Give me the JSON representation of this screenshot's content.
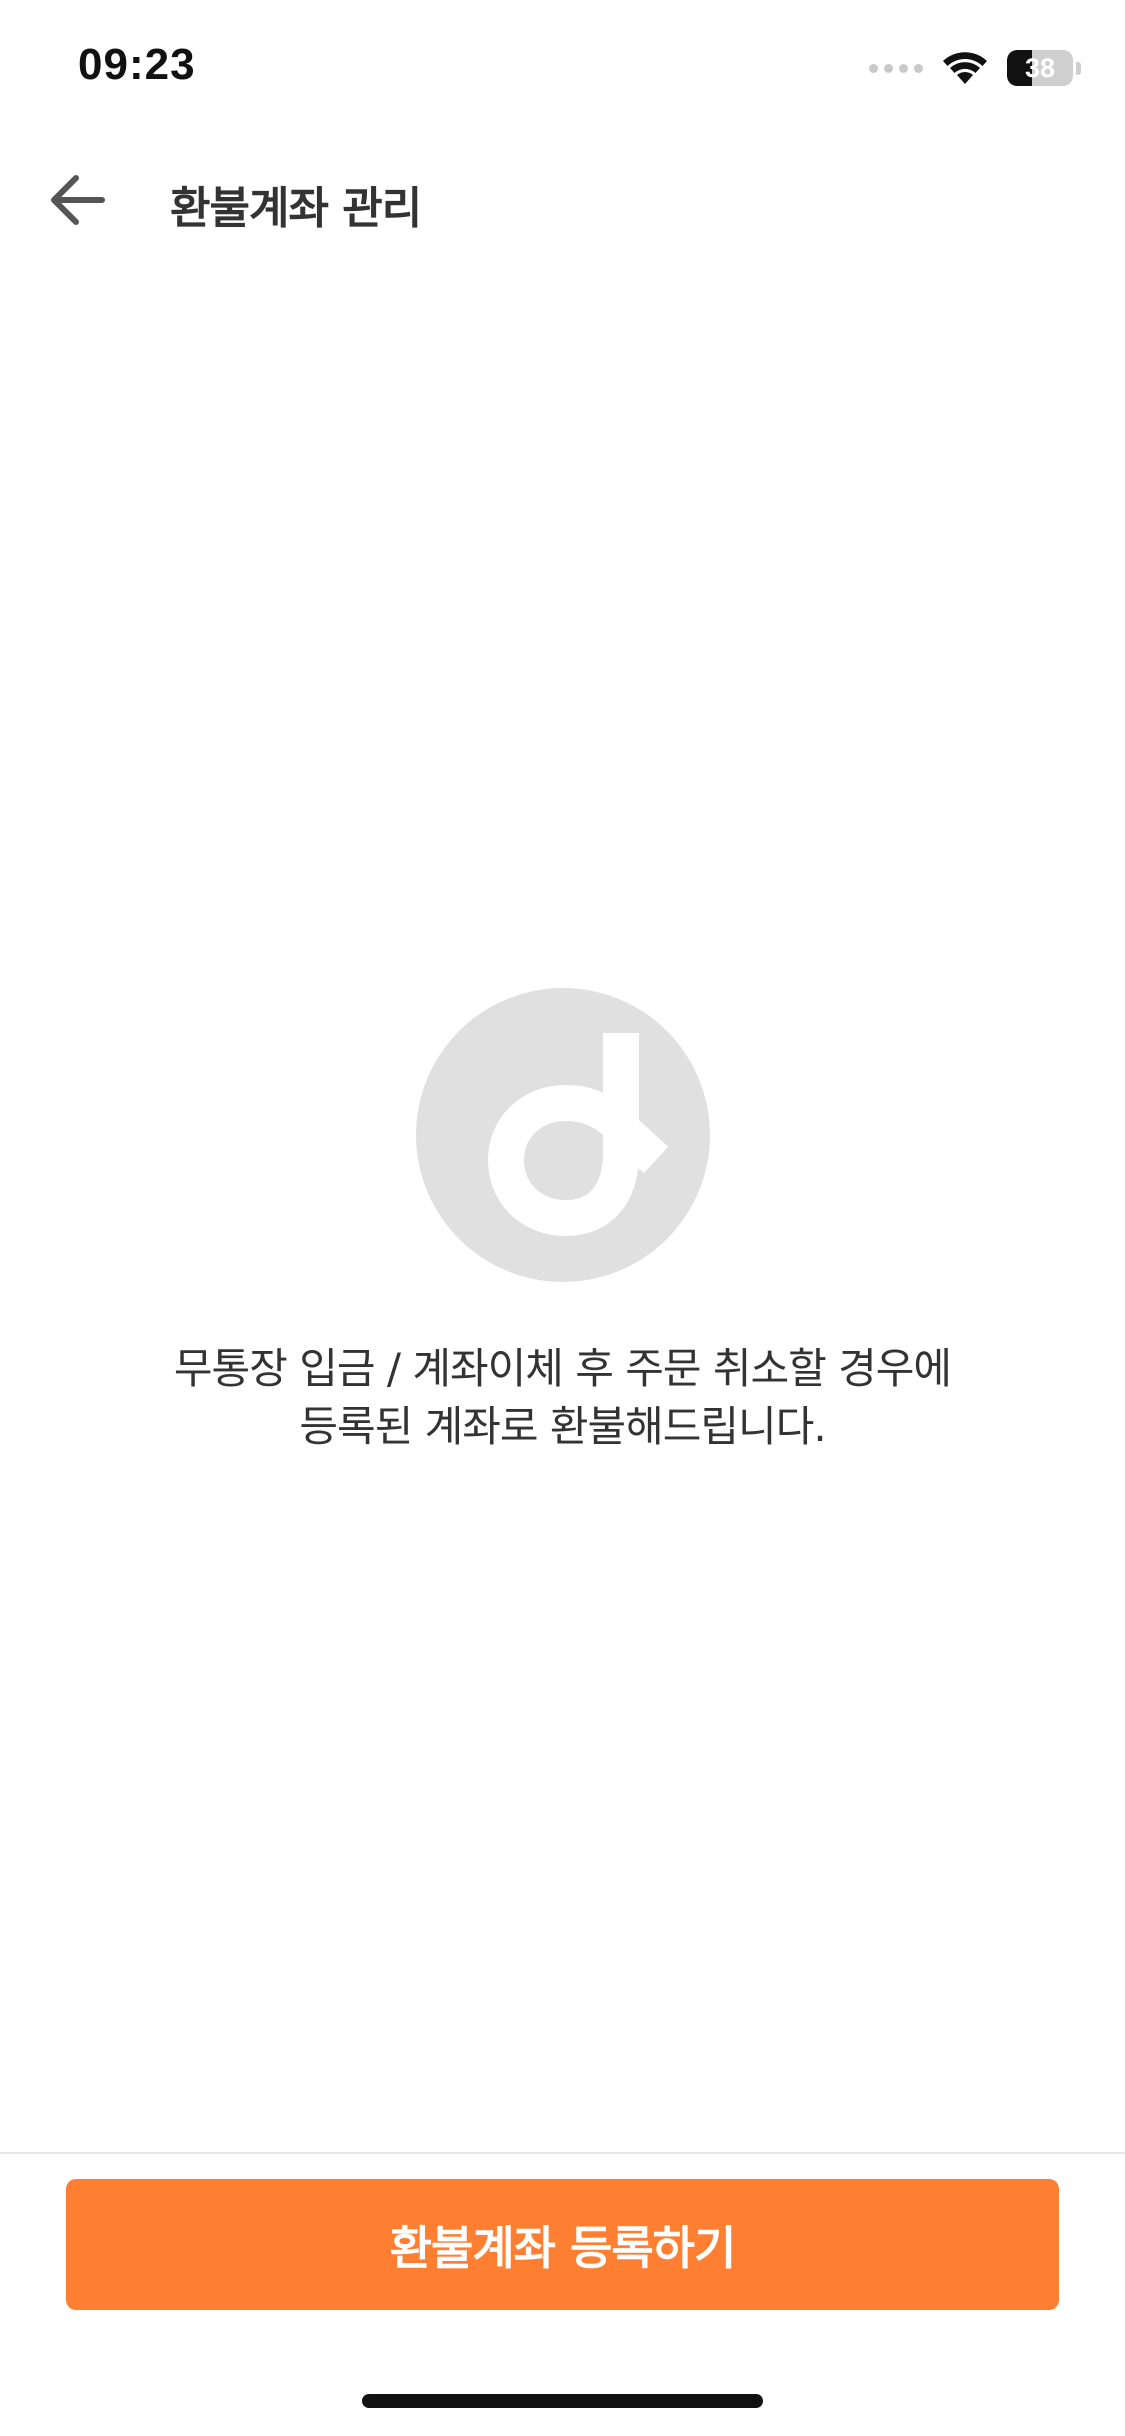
{
  "status_bar": {
    "time": "09:23",
    "battery_level": "38",
    "battery_fraction": 0.38,
    "icons": [
      "cellular-signal-icon",
      "wifi-icon",
      "battery-icon"
    ]
  },
  "header": {
    "back_icon": "arrow-left-icon",
    "title": "환불계좌 관리"
  },
  "empty_state": {
    "logo_icon": "brand-logo-icon",
    "message_lines": [
      "무통장 입금 / 계좌이체 후 주문 취소할 경우에",
      "등록된 계좌로 환불해드립니다."
    ]
  },
  "footer": {
    "register_button_label": "환불계좌 등록하기"
  },
  "colors": {
    "accent": "#ff7f32",
    "logo_circle": "#e0e0e0",
    "text_primary": "#333333",
    "divider": "#e6e6e6"
  }
}
